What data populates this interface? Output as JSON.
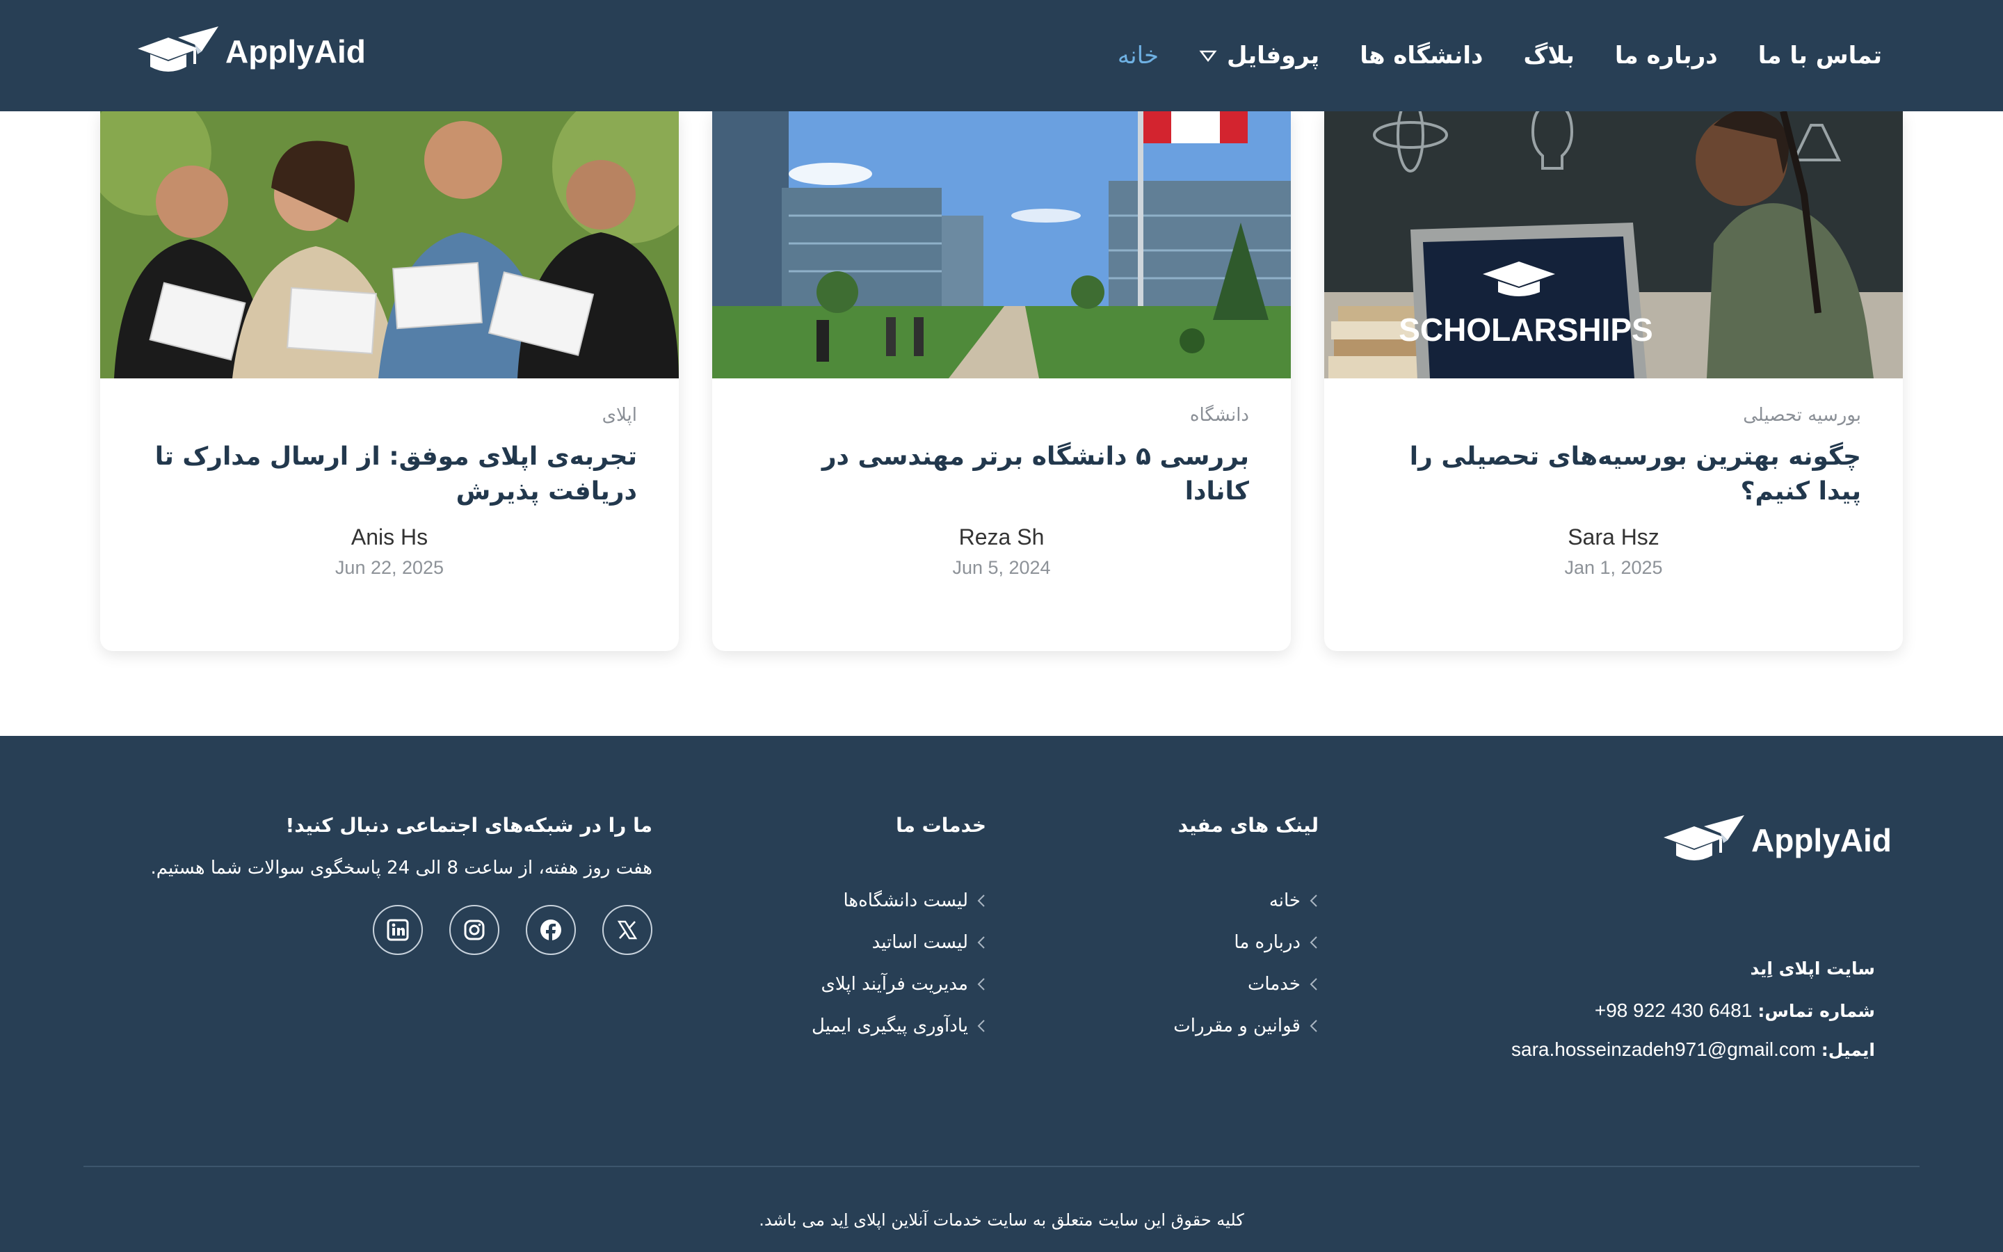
{
  "header": {
    "brand": "ApplyAid",
    "nav": [
      {
        "label": "خانه",
        "active": true
      },
      {
        "label": "پروفایل",
        "has_dropdown": true
      },
      {
        "label": "دانشگاه ها"
      },
      {
        "label": "بلاگ"
      },
      {
        "label": "درباره ما"
      },
      {
        "label": "تماس با ما"
      }
    ]
  },
  "cards": [
    {
      "category": "بورسیه تحصیلی",
      "title": "چگونه بهترین بورسیه‌های تحصیلی را پیدا کنیم؟",
      "author": "Sara Hsz",
      "date": "Jan 1, 2025",
      "image_text": "SCHOLARSHIPS"
    },
    {
      "category": "دانشگاه",
      "title": "بررسی ۵ دانشگاه برتر مهندسی در کانادا",
      "author": "Reza Sh",
      "date": "Jun 5, 2024"
    },
    {
      "category": "اپلای",
      "title": "تجربه‌ی اپلای موفق: از ارسال مدارک تا دریافت پذیرش",
      "author": "Anis Hs",
      "date": "Jun 22, 2025"
    }
  ],
  "footer": {
    "brand": "ApplyAid",
    "site_name": "سایت اپلای اِید",
    "phone_label": "شماره تماس:",
    "phone": "+98 922 430 6481",
    "email_label": "ایمیل:",
    "email": "sara.hosseinzadeh971@gmail.com",
    "useful_links": {
      "title": "لینک های مفید",
      "items": [
        "خانه",
        "درباره ما",
        "خدمات",
        "قوانین و مقررات"
      ]
    },
    "services": {
      "title": "خدمات ما",
      "items": [
        "لیست دانشگاه‌ها",
        "لیست اساتید",
        "مدیریت فرآیند اپلای",
        "یادآوری پیگیری ایمیل"
      ]
    },
    "social": {
      "title": "ما را در شبکه‌های اجتماعی دنبال کنید!",
      "text": "هفت روز هفته، از ساعت 8 الی 24 پاسخگوی سوالات شما هستیم.",
      "icons": [
        "x-icon",
        "facebook-icon",
        "instagram-icon",
        "linkedin-icon"
      ]
    },
    "copyright": "کلیه حقوق این سایت متعلق به سایت خدمات آنلاین اپلای اِید می باشد."
  },
  "colors": {
    "navy": "#283f55",
    "accent": "#6fb1e3"
  }
}
